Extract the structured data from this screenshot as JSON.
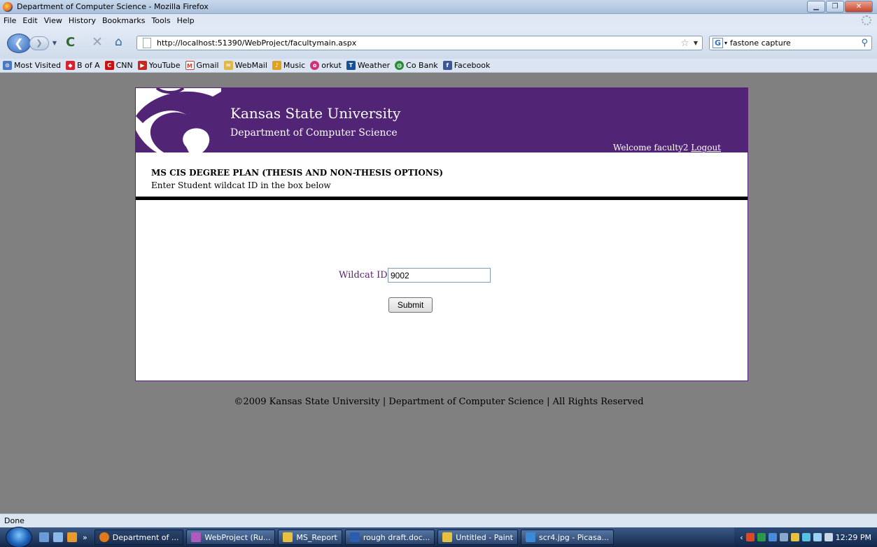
{
  "window": {
    "title": "Department of Computer Science - Mozilla Firefox"
  },
  "menu": [
    "File",
    "Edit",
    "View",
    "History",
    "Bookmarks",
    "Tools",
    "Help"
  ],
  "toolbar": {
    "url": "http://localhost:51390/WebProject/facultymain.aspx",
    "search_text": "fastone capture"
  },
  "bookmarks": [
    {
      "label": "Most Visited",
      "icon": "most-visited-icon",
      "color": "#4a78c8"
    },
    {
      "label": "B of A",
      "icon": "bofa-icon",
      "color": "#d8212f"
    },
    {
      "label": "CNN",
      "icon": "cnn-icon",
      "color": "#cc1111"
    },
    {
      "label": "YouTube",
      "icon": "youtube-icon",
      "color": "#c8281e"
    },
    {
      "label": "Gmail",
      "icon": "gmail-icon",
      "color": "#d93b2b"
    },
    {
      "label": "WebMail",
      "icon": "mail-icon",
      "color": "#e0b84a"
    },
    {
      "label": "Music",
      "icon": "music-icon",
      "color": "#e0a020"
    },
    {
      "label": "orkut",
      "icon": "orkut-icon",
      "color": "#d0307a"
    },
    {
      "label": "Weather",
      "icon": "weather-icon",
      "color": "#1a4f9a"
    },
    {
      "label": "Co Bank",
      "icon": "globe-icon",
      "color": "#2a8a3a"
    },
    {
      "label": "Facebook",
      "icon": "facebook-icon",
      "color": "#3b5998"
    }
  ],
  "page": {
    "university": "Kansas State University",
    "department": "Department of Computer Science",
    "welcome_text": "Welcome faculty2",
    "logout_label": "Logout",
    "plan_title": "MS CIS DEGREE PLAN (THESIS AND NON-THESIS OPTIONS)",
    "instruction": "Enter Student wildcat ID in the box below",
    "wildcat_label": "Wildcat ID",
    "wildcat_value": "9002",
    "submit_label": "Submit",
    "footer": "©2009 Kansas State University | Department of Computer Science | All Rights Reserved",
    "brand_color": "#512475"
  },
  "status": {
    "text": "Done"
  },
  "taskbar": {
    "tasks": [
      {
        "label": "Department of ...",
        "color": "#e07a1a"
      },
      {
        "label": "WebProject (Ru...",
        "color": "#b05ac0"
      },
      {
        "label": "MS_Report",
        "color": "#e8c040"
      },
      {
        "label": "rough draft.doc...",
        "color": "#2a5cb0"
      },
      {
        "label": "Untitled - Paint",
        "color": "#e8c040"
      },
      {
        "label": "scr4.jpg - Picasa...",
        "color": "#3a8ad8"
      }
    ],
    "clock": "12:29 PM"
  }
}
